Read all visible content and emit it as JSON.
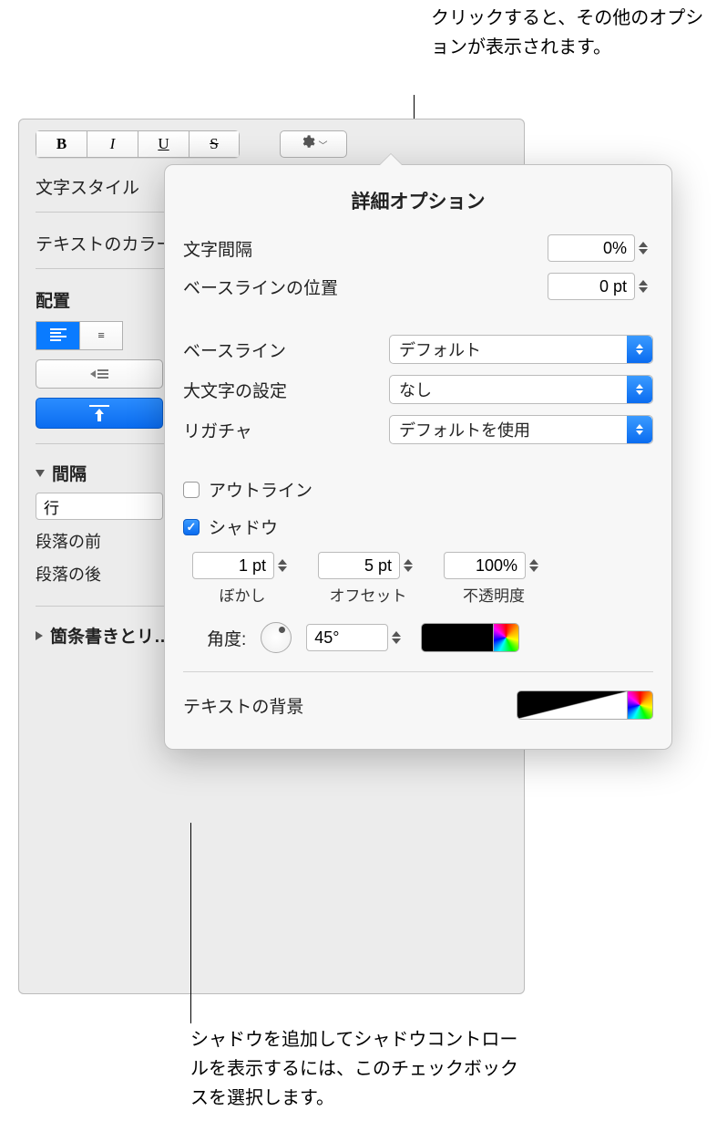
{
  "callouts": {
    "top": "クリックすると、その他のオプションが表示されます。",
    "bottom": "シャドウを追加してシャドウコントロールを表示するには、このチェックボックスを選択します。"
  },
  "inspector": {
    "char_style_label": "文字スタイル",
    "text_color_label": "テキストのカラー",
    "alignment_label": "配置",
    "spacing_label": "間隔",
    "line_value": "行",
    "before_label": "段落の前",
    "after_label": "段落の後",
    "bullets_label": "箇条書きとリ…"
  },
  "popover": {
    "title": "詳細オプション",
    "char_spacing_label": "文字間隔",
    "char_spacing_value": "0%",
    "baseline_pos_label": "ベースラインの位置",
    "baseline_pos_value": "0 pt",
    "baseline_label": "ベースライン",
    "baseline_value": "デフォルト",
    "caps_label": "大文字の設定",
    "caps_value": "なし",
    "ligature_label": "リガチャ",
    "ligature_value": "デフォルトを使用",
    "outline_label": "アウトライン",
    "outline_checked": false,
    "shadow_label": "シャドウ",
    "shadow_checked": true,
    "shadow": {
      "blur_value": "1 pt",
      "blur_label": "ぼかし",
      "offset_value": "5 pt",
      "offset_label": "オフセット",
      "opacity_value": "100%",
      "opacity_label": "不透明度",
      "angle_label": "角度:",
      "angle_value": "45°",
      "color": "#000000"
    },
    "text_bg_label": "テキストの背景"
  }
}
